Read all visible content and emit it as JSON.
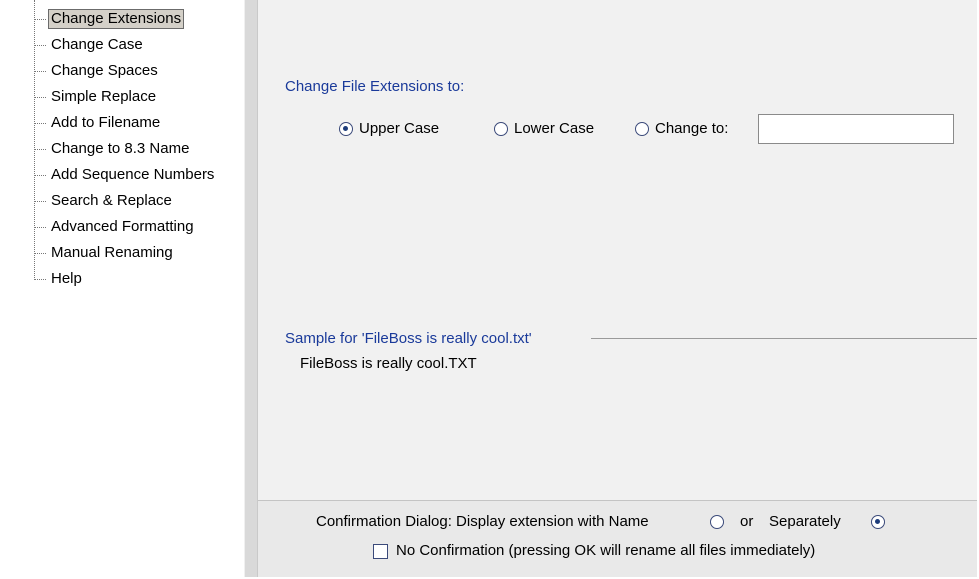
{
  "tree": {
    "items": [
      {
        "label": "Change Extensions",
        "selected": true
      },
      {
        "label": "Change Case"
      },
      {
        "label": "Change Spaces"
      },
      {
        "label": "Simple Replace"
      },
      {
        "label": "Add to Filename"
      },
      {
        "label": "Change to 8.3 Name"
      },
      {
        "label": "Add Sequence Numbers"
      },
      {
        "label": "Search & Replace"
      },
      {
        "label": "Advanced Formatting"
      },
      {
        "label": "Manual Renaming"
      },
      {
        "label": "Help"
      }
    ]
  },
  "extensions": {
    "title": "Change File Extensions to:",
    "options": [
      {
        "label": "Upper Case",
        "selected": true
      },
      {
        "label": "Lower Case",
        "selected": false
      },
      {
        "label": "Change to:",
        "selected": false
      }
    ],
    "change_to_value": ""
  },
  "sample": {
    "title": "Sample for 'FileBoss is really cool.txt'",
    "value": "FileBoss is really cool.TXT"
  },
  "confirmation": {
    "label": "Confirmation Dialog: Display extension with Name",
    "with_name_selected": false,
    "or_label": "or",
    "separately_label": "Separately",
    "separately_selected": true,
    "no_confirmation_label": "No Confirmation (pressing OK will rename all files immediately)",
    "no_confirmation_checked": false
  }
}
